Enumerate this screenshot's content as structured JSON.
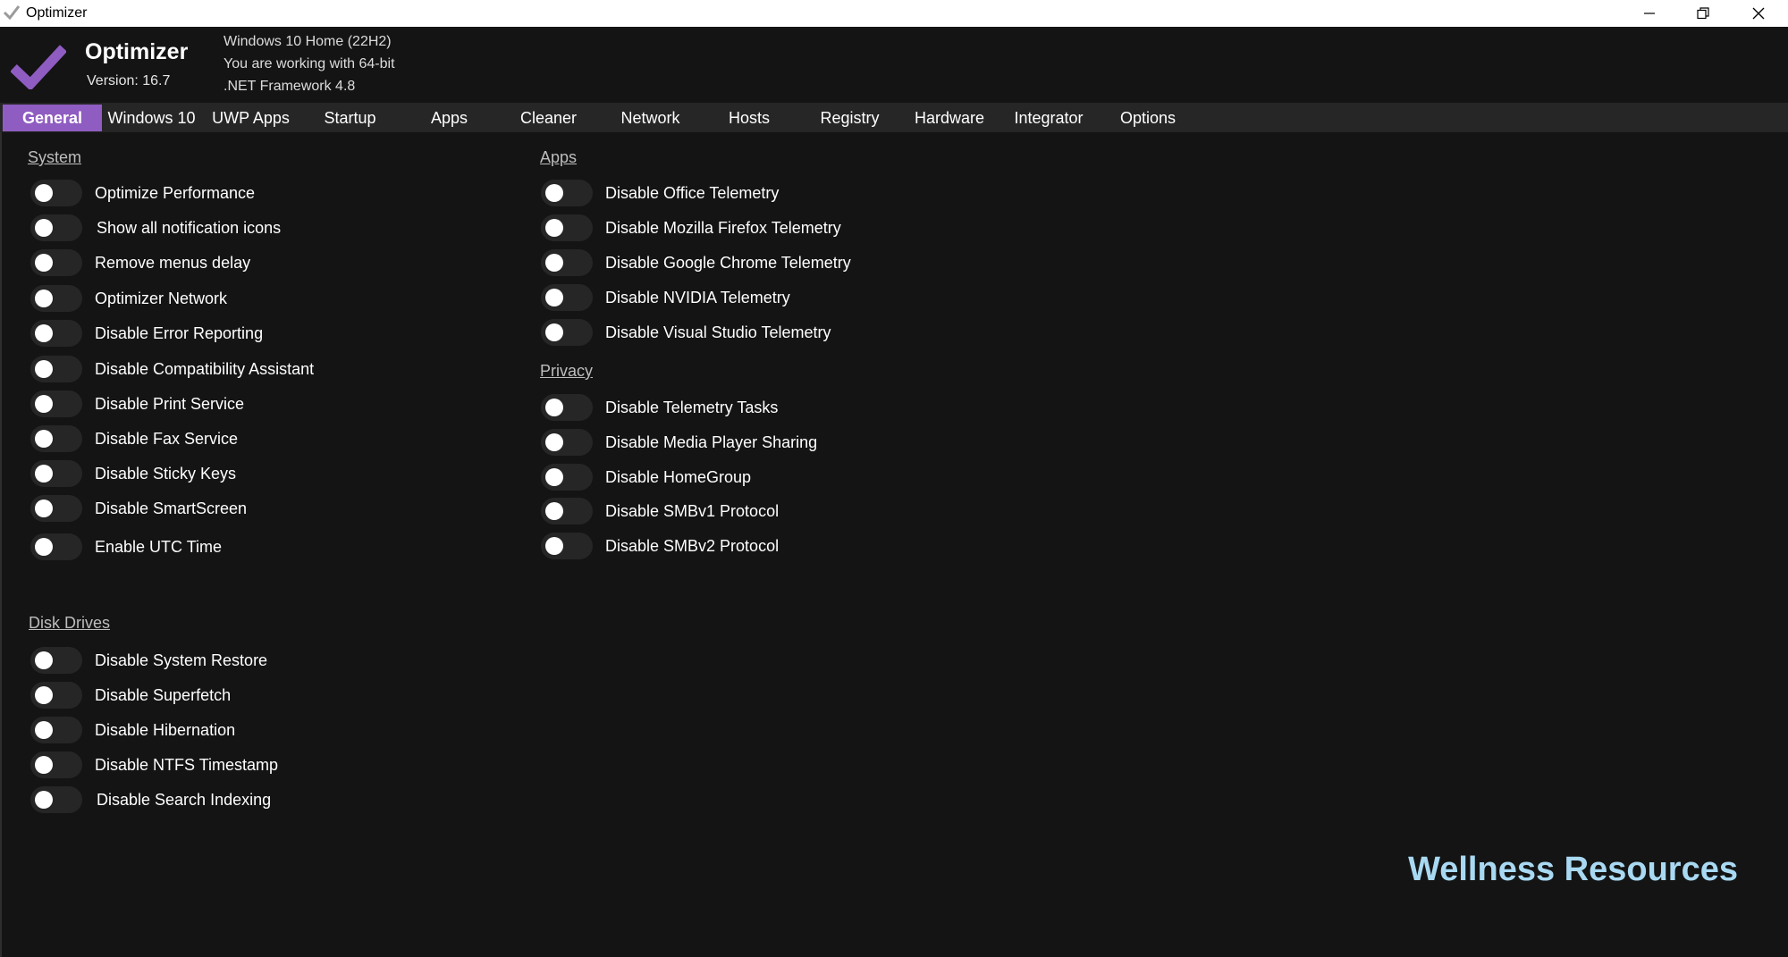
{
  "window": {
    "title": "Optimizer",
    "controls": [
      "minimize-icon",
      "restore-icon",
      "close-icon"
    ]
  },
  "header": {
    "app_name": "Optimizer",
    "version": "Version: 16.7",
    "os": "Windows 10 Home (22H2)",
    "arch": "You are working with 64-bit",
    "framework": ".NET Framework 4.8",
    "accent": "#8f5cc2"
  },
  "tabs": [
    {
      "label": "General",
      "active": true
    },
    {
      "label": "Windows 10"
    },
    {
      "label": "UWP Apps"
    },
    {
      "label": "Startup"
    },
    {
      "label": "Apps"
    },
    {
      "label": "Cleaner"
    },
    {
      "label": "Network"
    },
    {
      "label": "Hosts"
    },
    {
      "label": "Registry"
    },
    {
      "label": "Hardware"
    },
    {
      "label": "Integrator"
    },
    {
      "label": "Options"
    }
  ],
  "sections": {
    "system": {
      "title": "System",
      "items": [
        {
          "label": "Optimize Performance",
          "on": false
        },
        {
          "label": "Show all notification icons",
          "on": false
        },
        {
          "label": "Remove menus delay",
          "on": false
        },
        {
          "label": "Optimizer Network",
          "on": false
        },
        {
          "label": "Disable Error Reporting",
          "on": false
        },
        {
          "label": "Disable Compatibility Assistant",
          "on": false
        },
        {
          "label": "Disable Print Service",
          "on": false
        },
        {
          "label": "Disable Fax Service",
          "on": false
        },
        {
          "label": "Disable Sticky Keys",
          "on": false
        },
        {
          "label": "Disable SmartScreen",
          "on": false
        },
        {
          "label": "Enable UTC Time",
          "on": false
        }
      ]
    },
    "disk": {
      "title": "Disk Drives",
      "items": [
        {
          "label": "Disable System Restore",
          "on": false
        },
        {
          "label": "Disable Superfetch",
          "on": false
        },
        {
          "label": "Disable Hibernation",
          "on": false
        },
        {
          "label": "Disable NTFS Timestamp",
          "on": false
        },
        {
          "label": "Disable Search Indexing",
          "on": false
        }
      ]
    },
    "apps": {
      "title": "Apps",
      "items": [
        {
          "label": "Disable Office Telemetry",
          "on": false
        },
        {
          "label": "Disable Mozilla Firefox Telemetry",
          "on": false
        },
        {
          "label": "Disable Google Chrome Telemetry",
          "on": false
        },
        {
          "label": "Disable NVIDIA Telemetry",
          "on": false
        },
        {
          "label": "Disable Visual Studio Telemetry",
          "on": false
        }
      ]
    },
    "privacy": {
      "title": "Privacy",
      "items": [
        {
          "label": "Disable Telemetry Tasks",
          "on": false
        },
        {
          "label": "Disable Media Player Sharing",
          "on": false
        },
        {
          "label": "Disable HomeGroup",
          "on": false
        },
        {
          "label": "Disable SMBv1 Protocol",
          "on": false
        },
        {
          "label": "Disable SMBv2 Protocol",
          "on": false
        }
      ]
    }
  },
  "watermark": "Wellness Resources"
}
